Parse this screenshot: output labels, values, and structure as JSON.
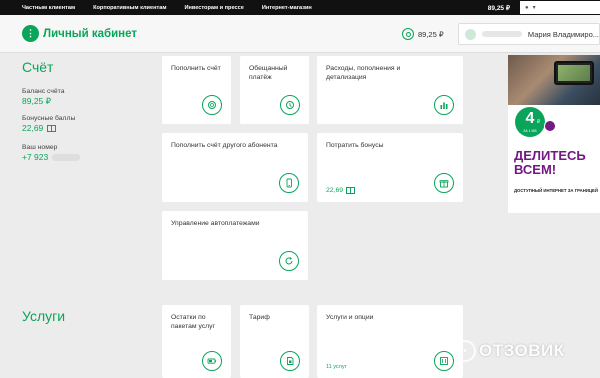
{
  "topnav": {
    "links": [
      "Частным клиентам",
      "Корпоративным клиентам",
      "Инвесторам и прессе",
      "Интернет-магазин"
    ],
    "balance": "89,25 ₽"
  },
  "header": {
    "logo_text": "Личный кабинет",
    "balance": "89,25 ₽",
    "user_name": "Мария Владимиро..."
  },
  "account": {
    "title": "Счёт",
    "balance_label": "Баланс счёта",
    "balance_value": "89,25 ₽",
    "bonus_label": "Бонусные баллы",
    "bonus_value": "22,69",
    "number_label": "Ваш номер",
    "number_value": "+7 923"
  },
  "cards": {
    "topup_self": "Пополнить счёт",
    "promised": "Обещанный платёж",
    "expenses": "Расходы, пополнения и детализация",
    "topup_other": "Пополнить счёт другого абонента",
    "spend_bonus": "Потратить бонусы",
    "spend_bonus_value": "22,69",
    "autopay": "Управление автоплатежами"
  },
  "services": {
    "title": "Услуги",
    "remains": "Остатки по пакетам услуг",
    "tariff": "Тариф",
    "options": "Услуги и опции",
    "options_count": "11 услуг"
  },
  "ad": {
    "price": "4",
    "price_unit": "₽",
    "per": "ЗА 1 МБ",
    "headline": "ДЕЛИТЕСЬ ВСЕМ!",
    "subline": "ДОСТУПНЫЙ ИНТЕРНЕТ ЗА ГРАНИЦЕЙ"
  },
  "watermark": "ОТЗОВИК",
  "colors": {
    "brand": "#0aa55b",
    "ad_purple": "#731982"
  }
}
